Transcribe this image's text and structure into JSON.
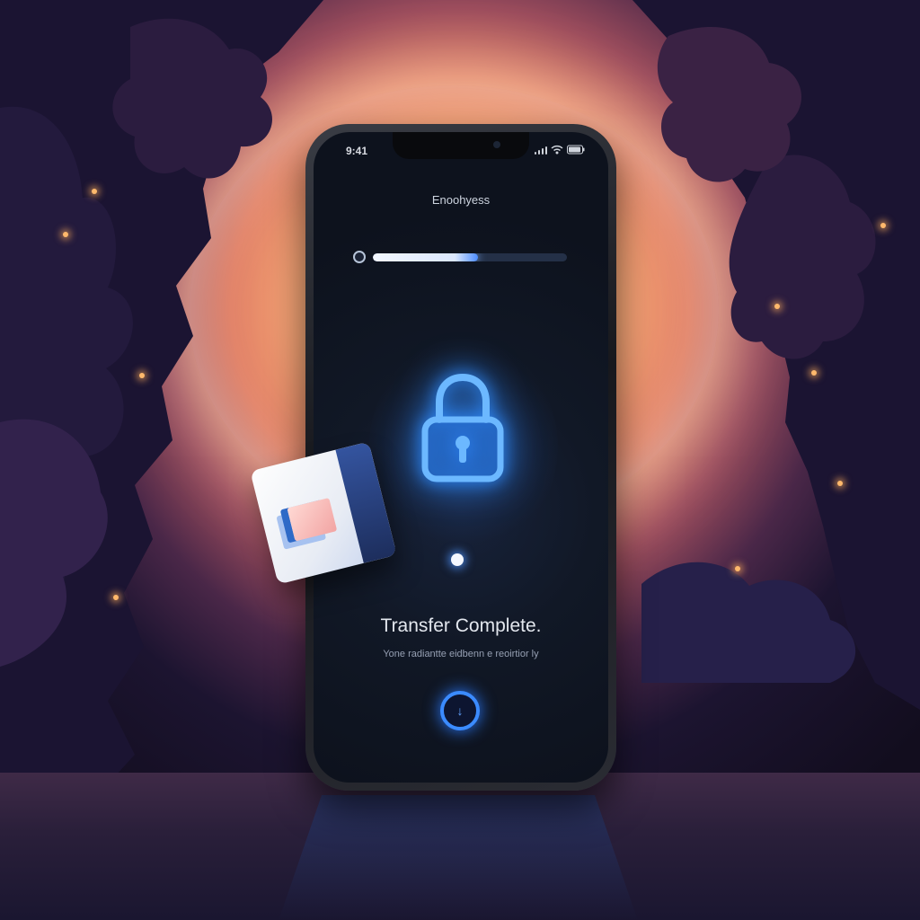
{
  "status_bar": {
    "time": "9:41",
    "icons": [
      "signal-icon",
      "wifi-icon",
      "battery-icon"
    ]
  },
  "screen": {
    "title": "Enoohyess",
    "progress_fraction": 0.54,
    "icon": "lock-icon",
    "headline": "Transfer Complete.",
    "subtitle": "Yone radiantte eidbenn e reoirtior ly",
    "action_icon": "download-icon"
  },
  "floating_card": {
    "icon": "image-card-icon"
  },
  "colors": {
    "accent_blue": "#2f8cff",
    "glow_blue": "#63a3ff",
    "screen_bg": "#0d121d",
    "moon_glow": "#ffe8c8",
    "forest_dark": "#1e1735",
    "firefly": "#ffb96c"
  }
}
